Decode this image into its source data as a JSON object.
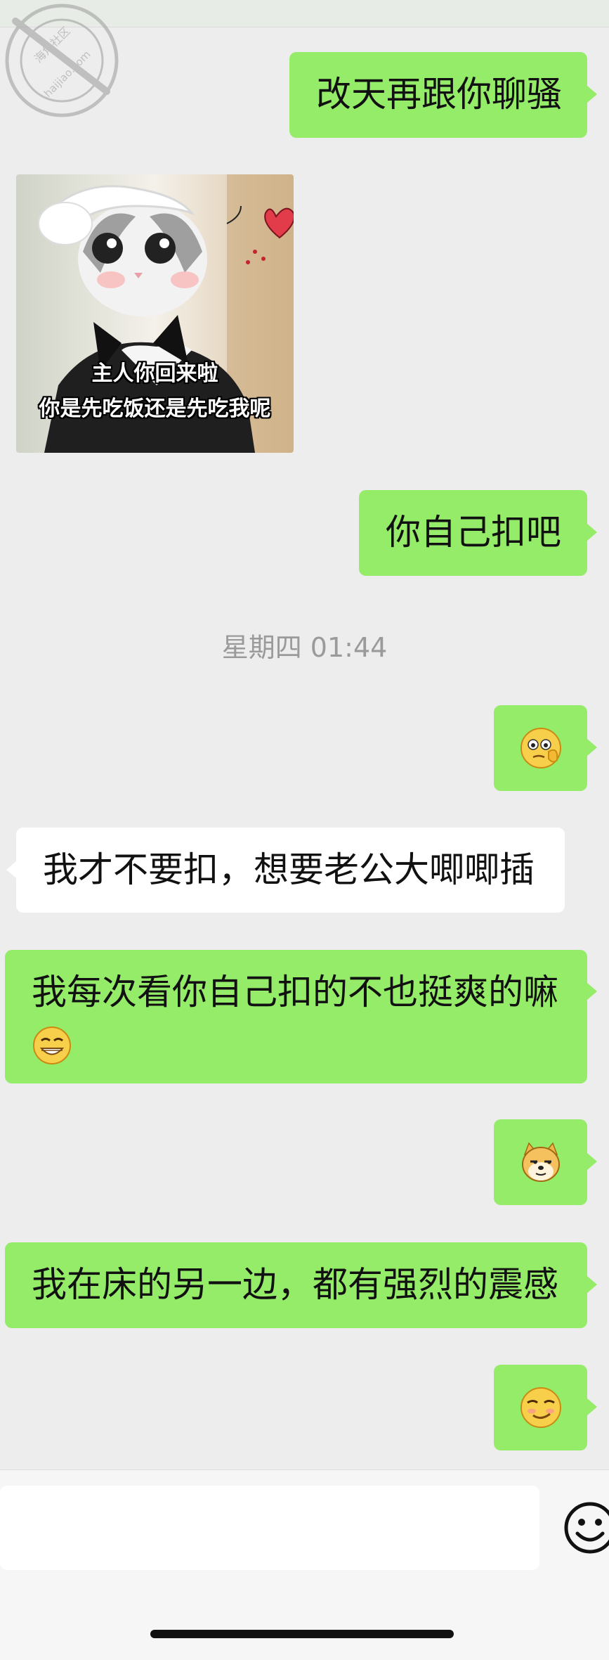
{
  "watermark": {
    "site_name": "海角社区",
    "site_url": "haijiao.com"
  },
  "messages": [
    {
      "id": "m1",
      "side": "right",
      "text": "改天再跟你聊骚"
    },
    {
      "id": "m2",
      "side": "left",
      "type": "sticker",
      "caption_line1": "主人你回来啦",
      "caption_line2": "你是先吃饭还是先吃我呢"
    },
    {
      "id": "m3",
      "side": "right",
      "text": "你自己扣吧"
    },
    {
      "id": "m5",
      "side": "right",
      "type": "emoji",
      "emoji": "thinking-face-emoji"
    },
    {
      "id": "m6",
      "side": "left",
      "text": "我才不要扣，想要老公大唧唧插"
    },
    {
      "id": "m7",
      "side": "right",
      "text": "我每次看你自己扣的不也挺爽的嘛",
      "trailing_emoji": "grin-emoji"
    },
    {
      "id": "m8",
      "side": "right",
      "type": "emoji",
      "emoji": "doge-emoji"
    },
    {
      "id": "m9",
      "side": "right",
      "text": "我在床的另一边，都有强烈的震感"
    },
    {
      "id": "m10",
      "side": "right",
      "type": "emoji",
      "emoji": "smirk-emoji"
    }
  ],
  "timestamp": "星期四 01:44",
  "colors": {
    "background": "#ededed",
    "outgoing_bubble": "#95ec69",
    "incoming_bubble": "#ffffff",
    "timestamp_text": "#9a9a9a"
  },
  "input_bar": {
    "emoji_button_icon": "smiley-face-icon"
  }
}
